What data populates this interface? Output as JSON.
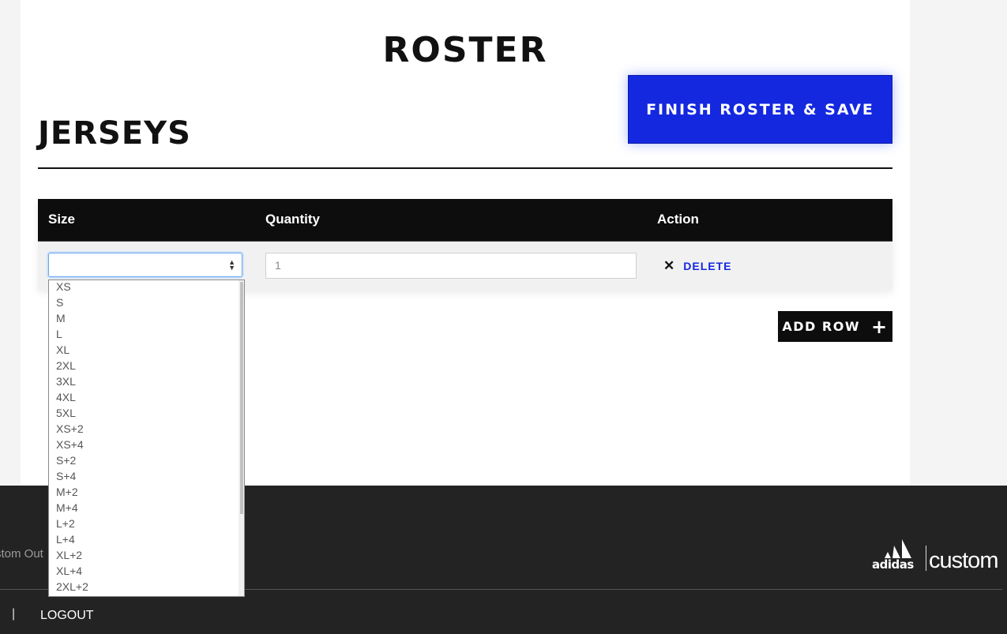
{
  "page": {
    "title": "ROSTER"
  },
  "toolbar": {
    "finish_label": "FINISH ROSTER & SAVE"
  },
  "section": {
    "title": "JERSEYS"
  },
  "table": {
    "headers": {
      "size": "Size",
      "quantity": "Quantity",
      "action": "Action"
    },
    "rows": [
      {
        "size": "",
        "quantity": "1",
        "delete_label": "DELETE"
      }
    ]
  },
  "actions": {
    "add_row_label": "ADD ROW"
  },
  "dropdown": {
    "options": [
      "XS",
      "S",
      "M",
      "L",
      "XL",
      "2XL",
      "3XL",
      "4XL",
      "5XL",
      "XS+2",
      "XS+4",
      "S+2",
      "S+4",
      "M+2",
      "M+4",
      "L+2",
      "L+4",
      "XL+2",
      "XL+4",
      "2XL+2"
    ]
  },
  "footer": {
    "text": "stom Out",
    "separator": "|",
    "logout_label": "LOGOUT",
    "brand": {
      "wordmark": "adidas",
      "suffix": "custom"
    }
  },
  "colors": {
    "accent": "#1428e0",
    "header_bg": "#0d0d0d",
    "footer_bg": "#232323"
  }
}
